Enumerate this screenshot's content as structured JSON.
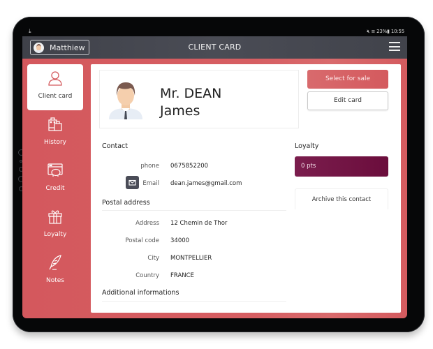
{
  "statusbar": {
    "download_icon": "download-icon",
    "mute_icon": "mute-icon",
    "signal_icon": "signal-icon",
    "battery": "23%",
    "battery_icon": "battery-icon",
    "time": "10:55"
  },
  "appbar": {
    "user_name": "Matthiew",
    "title": "CLIENT CARD",
    "menu_icon": "hamburger-menu-icon"
  },
  "nav": {
    "items": [
      {
        "label": "Client card",
        "icon": "user-icon",
        "active": true
      },
      {
        "label": "History",
        "icon": "shopping-bags-icon",
        "active": false
      },
      {
        "label": "Credit",
        "icon": "piggy-bank-window-icon",
        "active": false
      },
      {
        "label": "Loyalty",
        "icon": "gift-icon",
        "active": false
      },
      {
        "label": "Notes",
        "icon": "quill-icon",
        "active": false
      }
    ]
  },
  "client": {
    "title_lastname": "Mr. DEAN",
    "firstname": "James"
  },
  "actions": {
    "select_for_sale": "Select for sale",
    "edit_card": "Edit card",
    "archive": "Archive this contact"
  },
  "contact": {
    "heading": "Contact",
    "phone_label": "phone",
    "phone_value": "0675852200",
    "email_label": "Email",
    "email_value": "dean.james@gmail.com"
  },
  "postal": {
    "heading": "Postal address",
    "address_label": "Address",
    "address_value": "12 Chemin de Thor",
    "postal_code_label": "Postal code",
    "postal_code_value": "34000",
    "city_label": "City",
    "city_value": "MONTPELLIER",
    "country_label": "Country",
    "country_value": "FRANCE"
  },
  "additional": {
    "heading": "Additional informations"
  },
  "loyalty": {
    "heading": "Loyalty",
    "points": "0 pts"
  },
  "colors": {
    "brand_red": "#d45a5e",
    "appbar": "#45474f",
    "loyalty_purple": "#6f1240",
    "mail_button": "#4a4c57"
  }
}
